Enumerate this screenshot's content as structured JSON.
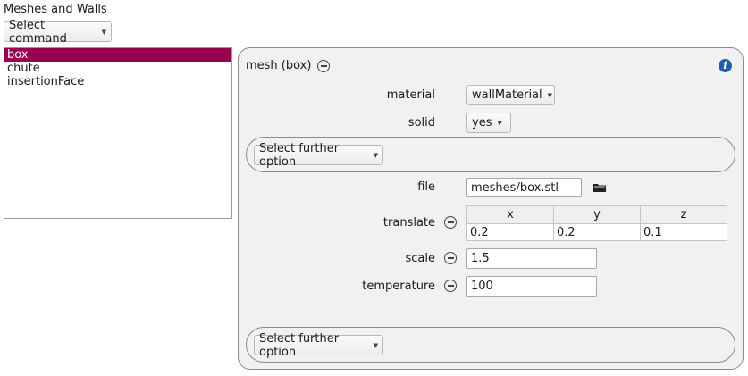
{
  "title": "Meshes and Walls",
  "command": {
    "label": "Select command"
  },
  "list": {
    "items": [
      {
        "label": "box",
        "selected": true
      },
      {
        "label": "chute"
      },
      {
        "label": "insertionFace"
      }
    ]
  },
  "panel": {
    "header": "mesh (box)",
    "material": {
      "label": "material",
      "value": "wallMaterial"
    },
    "solid": {
      "label": "solid",
      "value": "yes"
    },
    "further_option_top": "Select further option",
    "file": {
      "label": "file",
      "value": "meshes/box.stl"
    },
    "translate": {
      "label": "translate",
      "columns": [
        "x",
        "y",
        "z"
      ],
      "values": [
        "0.2",
        "0.2",
        "0.1"
      ]
    },
    "scale": {
      "label": "scale",
      "value": "1.5"
    },
    "temperature": {
      "label": "temperature",
      "value": "100"
    },
    "further_option_bottom": "Select further option"
  },
  "colors": {
    "selection": "#99004d",
    "info": "#1d5fa8"
  },
  "icons": {
    "info": "info-icon",
    "folder": "folder-icon",
    "remove": "minus-circle-icon"
  }
}
